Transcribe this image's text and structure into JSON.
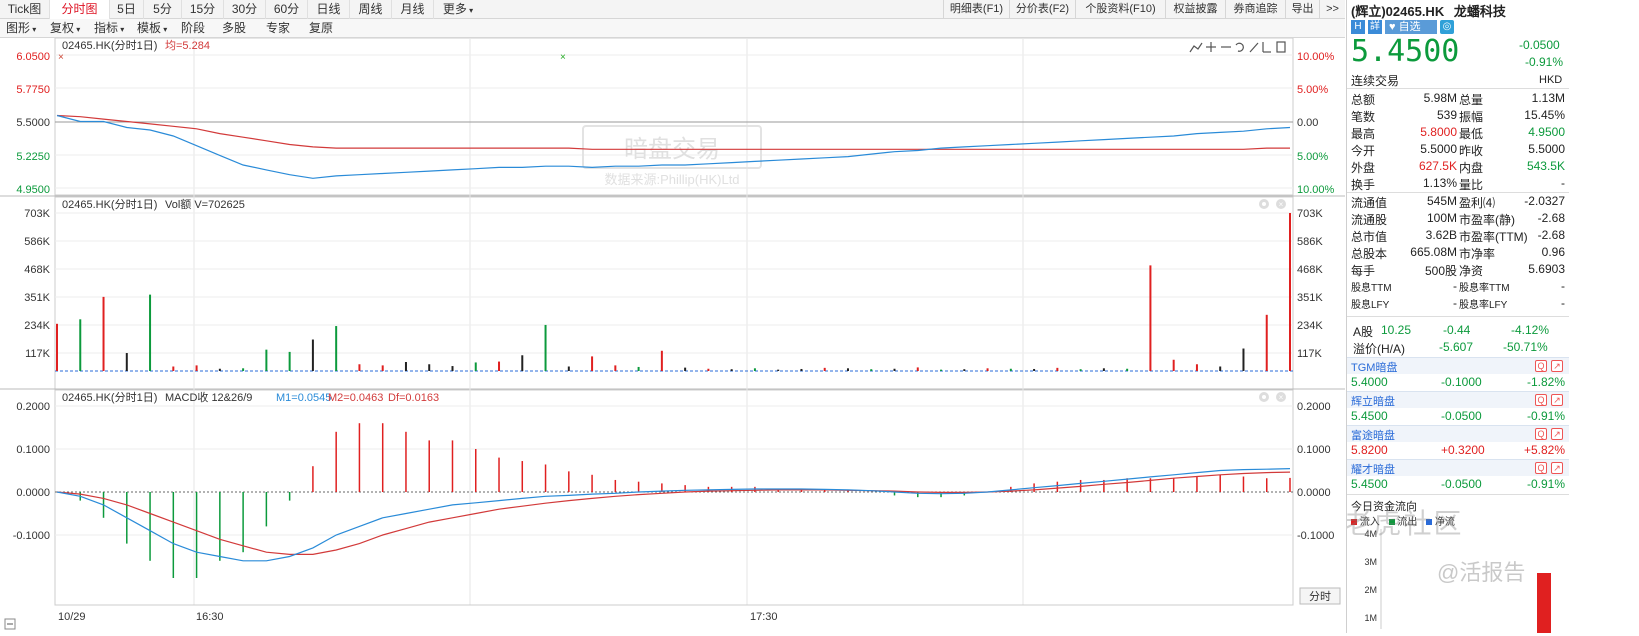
{
  "topbar": {
    "tabs": [
      "Tick图",
      "分时图",
      "5日",
      "5分",
      "15分",
      "30分",
      "60分",
      "日线",
      "周线",
      "月线",
      "更多"
    ],
    "active": "分时图",
    "right_tabs": [
      "明细表(F1)",
      "分价表(F2)",
      "个股资料(F10)",
      "权益披露",
      "券商追踪",
      "导出",
      ">>"
    ]
  },
  "toolbar": {
    "items": [
      "图形",
      "复权",
      "指标",
      "模板",
      "阶段",
      "多股",
      "专家",
      "复原"
    ]
  },
  "panel1": {
    "legend_code": "02465.HK(分时1日)",
    "legend_avg": "均=5.284",
    "y_labels": [
      "6.0500",
      "5.7750",
      "5.5000",
      "5.2250",
      "4.9500"
    ],
    "pct_labels": [
      "10.00%",
      "5.00%",
      "0.00",
      "5.00%",
      "10.00%"
    ],
    "watermark_title": "暗盘交易",
    "watermark_source": "数据来源:Phillip(HK)Ltd"
  },
  "panel2": {
    "legend_code": "02465.HK(分时1日)",
    "legend_vol": "Vol额 V=702625",
    "y_labels": [
      "703K",
      "586K",
      "468K",
      "351K",
      "234K",
      "117K"
    ]
  },
  "panel3": {
    "legend_code": "02465.HK(分时1日)",
    "legend_name": "MACD收 12&26/9",
    "legend_m1": "M1=0.0545",
    "legend_m2": "M2=0.0463",
    "legend_df": "Df=0.0163",
    "y_labels": [
      "0.2000",
      "0.1000",
      "0.0000",
      "-0.1000"
    ],
    "x_labels": [
      "10/29",
      "16:30",
      "17:30"
    ],
    "time_button": "分时"
  },
  "quote": {
    "prefix": "(辉立)",
    "code": "02465.HK",
    "name": "龙蟠科技",
    "price": "5.4500",
    "change": "-0.0500",
    "change_pct": "-0.91%",
    "status": "连续交易",
    "currency": "HKD",
    "btn_self": "自选",
    "stats": [
      [
        "总额",
        "5.98M",
        "总量",
        "1.13M"
      ],
      [
        "笔数",
        "539",
        "振幅",
        "15.45%"
      ],
      [
        "最高",
        "5.8000",
        "最低",
        "4.9500"
      ],
      [
        "今开",
        "5.5000",
        "昨收",
        "5.5000"
      ],
      [
        "外盘",
        "627.5K",
        "内盘",
        "543.5K"
      ],
      [
        "换手",
        "1.13%",
        "量比",
        "-"
      ]
    ],
    "fund": [
      [
        "流通值",
        "545M",
        "盈利⑷",
        "-2.0327"
      ],
      [
        "流通股",
        "100M",
        "市盈率(静)",
        "-2.68"
      ],
      [
        "总市值",
        "3.62B",
        "市盈率(TTM)",
        "-2.68"
      ],
      [
        "总股本",
        "665.08M",
        "市净率",
        "0.96"
      ],
      [
        "每手",
        "500股",
        "净资",
        "5.6903"
      ],
      [
        "股息TTM",
        "-",
        "股息率TTM",
        "-"
      ],
      [
        "股息LFY",
        "-",
        "股息率LFY",
        "-"
      ]
    ],
    "a_share": {
      "label": "A股",
      "price": "10.25",
      "change": "-0.44",
      "pct": "-4.12%"
    },
    "premium": {
      "label": "溢价(H/A)",
      "value": "-5.607",
      "pct": "-50.71%"
    },
    "dark_pools": [
      {
        "name": "TGM暗盘",
        "price": "5.4000",
        "change": "-0.1000",
        "pct": "-1.82%"
      },
      {
        "name": "辉立暗盘",
        "price": "5.4500",
        "change": "-0.0500",
        "pct": "-0.91%"
      },
      {
        "name": "富途暗盘",
        "price": "5.8200",
        "change": "+0.3200",
        "pct": "+5.82%"
      },
      {
        "name": "耀才暗盘",
        "price": "5.4500",
        "change": "-0.0500",
        "pct": "-0.91%"
      }
    ],
    "flow": {
      "title": "今日资金流向",
      "legend": [
        "流入",
        "流出",
        "净流"
      ],
      "y_labels": [
        "4M",
        "3M",
        "2M",
        "1M"
      ]
    },
    "watermark1": "老虎社区",
    "watermark2": "@活报告"
  },
  "colors": {
    "up": "#e02020",
    "down": "#0c9a3c",
    "price_line": "#2a8bd8",
    "avg_line": "#d23a3a",
    "neutral": "#222222"
  },
  "chart_data": {
    "price": [
      5.55,
      5.5,
      5.5,
      5.45,
      5.43,
      5.38,
      5.3,
      5.22,
      5.14,
      5.1,
      5.06,
      5.03,
      5.05,
      5.06,
      5.07,
      5.08,
      5.09,
      5.1,
      5.11,
      5.12,
      5.12,
      5.13,
      5.13,
      5.12,
      5.13,
      5.13,
      5.14,
      5.14,
      5.15,
      5.16,
      5.17,
      5.18,
      5.19,
      5.2,
      5.21,
      5.23,
      5.25,
      5.26,
      5.28,
      5.29,
      5.3,
      5.31,
      5.32,
      5.33,
      5.34,
      5.35,
      5.36,
      5.37,
      5.38,
      5.4,
      5.41,
      5.42,
      5.44,
      5.45
    ],
    "avg": [
      5.55,
      5.54,
      5.52,
      5.5,
      5.48,
      5.46,
      5.44,
      5.4,
      5.37,
      5.34,
      5.31,
      5.29,
      5.28,
      5.28,
      5.28,
      5.28,
      5.28,
      5.28,
      5.28,
      5.28,
      5.28,
      5.28,
      5.28,
      5.27,
      5.27,
      5.27,
      5.27,
      5.27,
      5.27,
      5.27,
      5.27,
      5.27,
      5.27,
      5.27,
      5.27,
      5.27,
      5.27,
      5.27,
      5.27,
      5.27,
      5.27,
      5.27,
      5.27,
      5.27,
      5.27,
      5.27,
      5.27,
      5.27,
      5.27,
      5.27,
      5.27,
      5.27,
      5.28,
      5.28
    ],
    "volume": [
      210000,
      230000,
      330000,
      80000,
      340000,
      20000,
      25000,
      10000,
      12000,
      95000,
      85000,
      140000,
      200000,
      30000,
      25000,
      40000,
      30000,
      22000,
      38000,
      42000,
      70000,
      205000,
      20000,
      65000,
      25000,
      18000,
      90000,
      15000,
      10000,
      8000,
      12000,
      6000,
      9000,
      14000,
      12000,
      8000,
      10000,
      16000,
      6000,
      8000,
      12000,
      10000,
      9000,
      14000,
      8000,
      12000,
      10000,
      470000,
      50000,
      30000,
      20000,
      100000,
      250000,
      703000
    ],
    "volume_dir": [
      "up",
      "down",
      "up",
      "neutral",
      "down",
      "up",
      "up",
      "neutral",
      "down",
      "down",
      "down",
      "neutral",
      "down",
      "up",
      "up",
      "neutral",
      "neutral",
      "neutral",
      "down",
      "up",
      "neutral",
      "down",
      "neutral",
      "up",
      "up",
      "down",
      "up",
      "neutral",
      "up",
      "neutral",
      "down",
      "neutral",
      "neutral",
      "up",
      "neutral",
      "down",
      "neutral",
      "up",
      "down",
      "neutral",
      "up",
      "down",
      "neutral",
      "up",
      "down",
      "neutral",
      "down",
      "up",
      "up",
      "up",
      "neutral",
      "neutral",
      "up",
      "up"
    ],
    "macd_m1": [
      0.0,
      -0.01,
      -0.03,
      -0.06,
      -0.09,
      -0.12,
      -0.14,
      -0.15,
      -0.16,
      -0.16,
      -0.15,
      -0.13,
      -0.1,
      -0.08,
      -0.06,
      -0.05,
      -0.04,
      -0.03,
      -0.025,
      -0.02,
      -0.015,
      -0.01,
      -0.008,
      -0.005,
      -0.003,
      0.0,
      0.002,
      0.004,
      0.005,
      0.006,
      0.007,
      0.007,
      0.007,
      0.006,
      0.005,
      0.003,
      0.0,
      -0.003,
      -0.004,
      -0.003,
      0.0,
      0.005,
      0.01,
      0.015,
      0.02,
      0.025,
      0.03,
      0.035,
      0.04,
      0.045,
      0.05,
      0.052,
      0.053,
      0.0545
    ],
    "macd_m2": [
      0.0,
      -0.005,
      -0.015,
      -0.03,
      -0.05,
      -0.07,
      -0.09,
      -0.11,
      -0.125,
      -0.14,
      -0.145,
      -0.145,
      -0.135,
      -0.12,
      -0.1,
      -0.085,
      -0.07,
      -0.06,
      -0.05,
      -0.04,
      -0.033,
      -0.026,
      -0.02,
      -0.015,
      -0.01,
      -0.006,
      -0.003,
      0.0,
      0.002,
      0.003,
      0.004,
      0.005,
      0.005,
      0.005,
      0.004,
      0.003,
      0.002,
      0.0,
      -0.001,
      -0.001,
      0.0,
      0.002,
      0.005,
      0.009,
      0.013,
      0.018,
      0.022,
      0.027,
      0.032,
      0.036,
      0.04,
      0.043,
      0.045,
      0.0463
    ]
  }
}
